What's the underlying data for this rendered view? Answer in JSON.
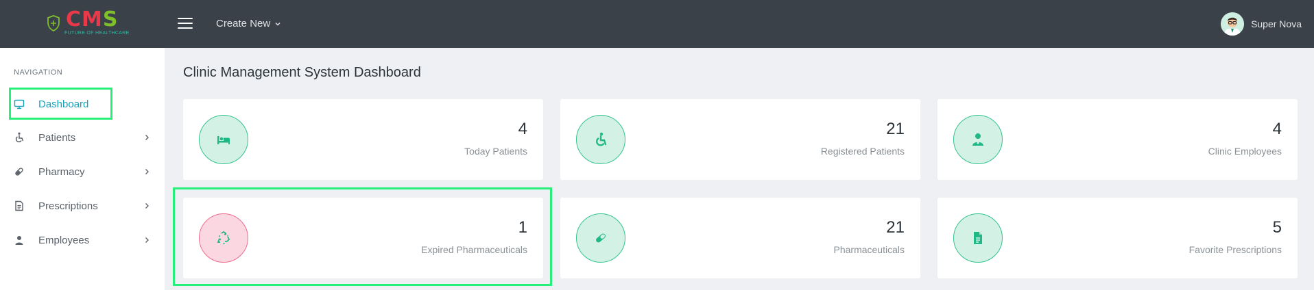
{
  "header": {
    "logo_text": "CMS",
    "logo_tagline": "FUTURE OF HEALTHCARE",
    "create_new_label": "Create New",
    "user_name": "Super Nova"
  },
  "sidebar": {
    "section_label": "NAVIGATION",
    "items": [
      {
        "label": "Dashboard",
        "icon": "monitor-icon",
        "active": true
      },
      {
        "label": "Patients",
        "icon": "wheelchair-icon"
      },
      {
        "label": "Pharmacy",
        "icon": "pill-icon"
      },
      {
        "label": "Prescriptions",
        "icon": "document-icon"
      },
      {
        "label": "Employees",
        "icon": "user-icon"
      }
    ]
  },
  "main": {
    "title": "Clinic Management System Dashboard",
    "cards": [
      {
        "value": "4",
        "label": "Today Patients",
        "icon": "bed-icon"
      },
      {
        "value": "21",
        "label": "Registered Patients",
        "icon": "wheelchair-icon"
      },
      {
        "value": "4",
        "label": "Clinic Employees",
        "icon": "doctor-icon"
      },
      {
        "value": "1",
        "label": "Expired Pharmaceuticals",
        "icon": "recycle-icon"
      },
      {
        "value": "21",
        "label": "Pharmaceuticals",
        "icon": "pill-icon"
      },
      {
        "value": "5",
        "label": "Favorite Prescriptions",
        "icon": "document-icon"
      }
    ]
  },
  "colors": {
    "topbar": "#3a4149",
    "accent": "#17a2b8",
    "icon_green": "#1fb886",
    "circle_green": "#d3f1e5",
    "circle_pink": "#fbd7e1",
    "highlight": "#27f07a"
  }
}
